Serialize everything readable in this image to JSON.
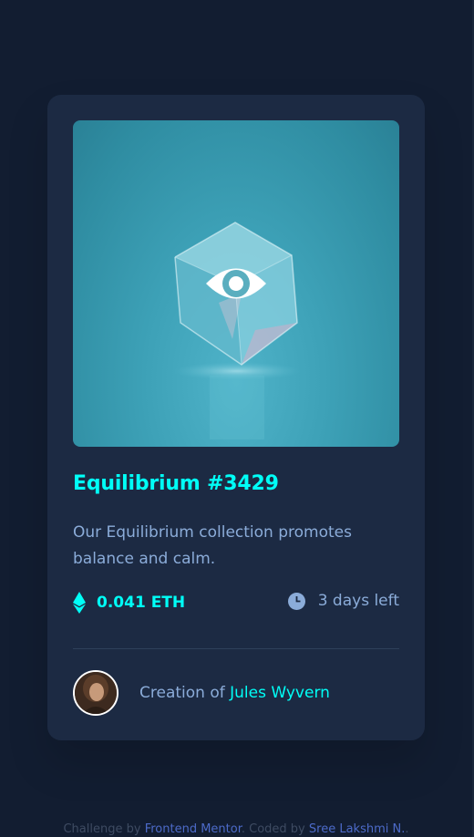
{
  "card": {
    "title": "Equilibrium #3429",
    "description": "Our Equilibrium collection promotes balance and calm.",
    "price": "0.041 ETH",
    "time_left": "3 days left",
    "creator_prefix": "Creation of ",
    "creator_name": "Jules Wyvern",
    "image_icon": "eye-icon"
  },
  "footer": {
    "prefix": "Challenge by ",
    "challenge_link": "Frontend Mentor",
    "middle": ". Coded by ",
    "author_link": "Sree Lakshmi N.",
    "suffix": "."
  },
  "colors": {
    "page_bg": "#121d31",
    "card_bg": "#1c2a43",
    "accent": "#00fff7",
    "muted_text": "#8bacd9",
    "divider": "#2e405a"
  }
}
